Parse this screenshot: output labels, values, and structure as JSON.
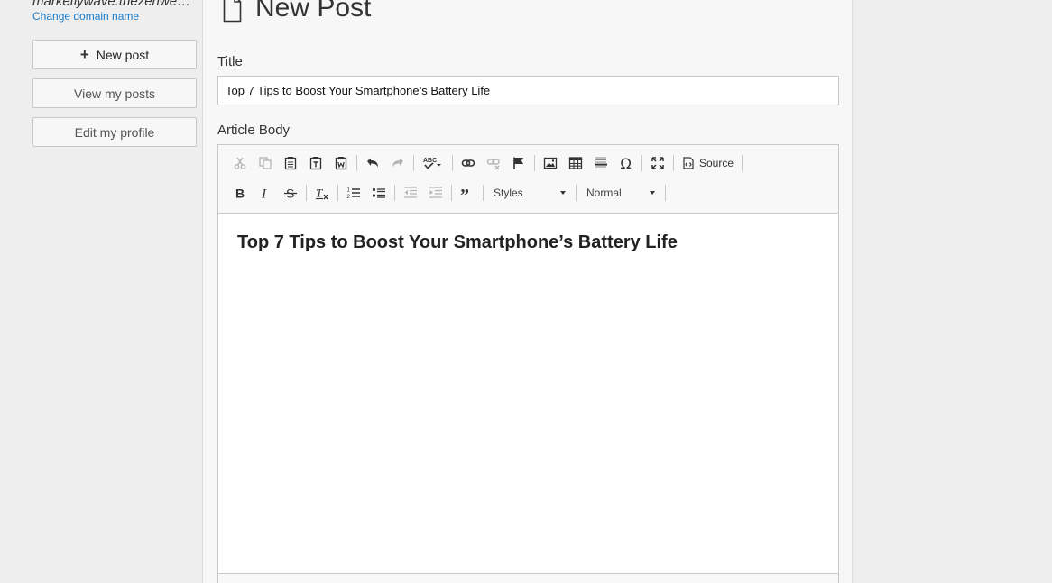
{
  "sidebar": {
    "domain": "marketlywave.thezenwe…",
    "change_domain": "Change domain name",
    "new_post": "New post",
    "view_posts": "View my posts",
    "edit_profile": "Edit my profile"
  },
  "main": {
    "page_title": "New Post",
    "title_label": "Title",
    "title_value": "Top 7 Tips to Boost Your Smartphone’s Battery Life",
    "body_label": "Article Body"
  },
  "editor": {
    "source_label": "Source",
    "styles_label": "Styles",
    "format_label": "Normal",
    "heading": "Top 7 Tips to Boost Your Smartphone’s Battery Life"
  },
  "colors": {
    "link": "#1a7bc9",
    "background": "#eeeeee",
    "panel": "#f7f7f7"
  }
}
